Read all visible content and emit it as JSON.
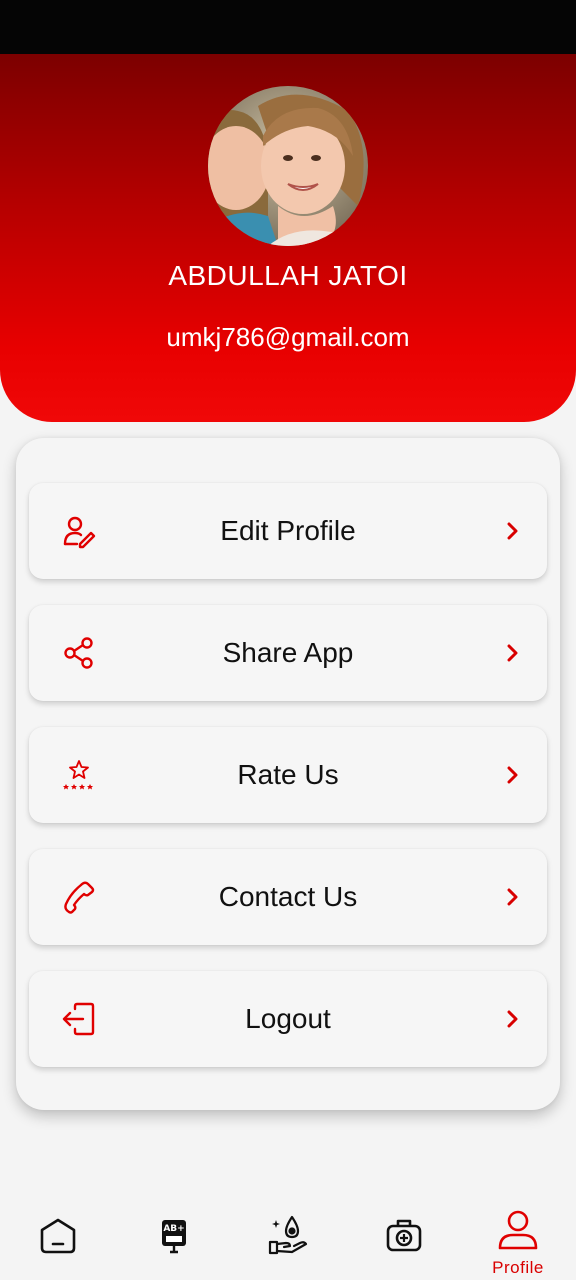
{
  "colors": {
    "accent": "#e00000",
    "header_dark": "#7c0000",
    "header_light": "#f00808",
    "background": "#f4f4f4"
  },
  "profile": {
    "name": "ABDULLAH JATOI",
    "email": "umkj786@gmail.com"
  },
  "menu": [
    {
      "label": "Edit Profile",
      "icon": "edit-profile-icon"
    },
    {
      "label": "Share App",
      "icon": "share-icon"
    },
    {
      "label": "Rate Us",
      "icon": "rate-stars-icon"
    },
    {
      "label": "Contact Us",
      "icon": "phone-icon"
    },
    {
      "label": "Logout",
      "icon": "logout-icon"
    }
  ],
  "bottom_nav": {
    "items": [
      {
        "icon": "home-icon"
      },
      {
        "icon": "blood-bag-icon",
        "badge": "AB+"
      },
      {
        "icon": "donate-drop-icon"
      },
      {
        "icon": "medical-kit-icon"
      },
      {
        "icon": "profile-icon",
        "label": "Profile",
        "active": true
      }
    ]
  }
}
